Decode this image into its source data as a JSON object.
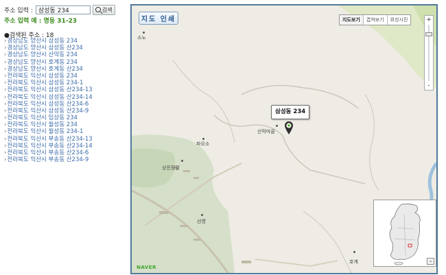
{
  "search": {
    "label": "주소 입력 :",
    "value": "삼성동 234",
    "button_label": "검색",
    "example": "주소 입력 예 : 명동 31-23"
  },
  "results": {
    "count_label": "●검색된 주소 : 18",
    "items": [
      "경상남도 양산시 삼성동 234",
      "경상남도 양산시 삼성동 산234",
      "경상남도 양산시 산막동 234",
      "경상남도 양산시 호계동 234",
      "경상남도 양산시 호계동 산234",
      "전라북도 익산시 삼성동 234",
      "전라북도 익산시 삼성동 234-1",
      "전라북도 익산시 삼성동 산234-13",
      "전라북도 익산시 삼성동 산234-14",
      "전라북도 익산시 삼성동 산234-6",
      "전라북도 익산시 삼성동 산234-9",
      "전라북도 익산시 임상동 234",
      "전라북도 익산시 월성동 234",
      "전라북도 익산시 월성동 234-1",
      "전라북도 익산시 부송동 산234-13",
      "전라북도 익산시 부송동 산234-14",
      "전라북도 익산시 부송동 산234-6",
      "전라북도 익산시 부송동 산234-9"
    ]
  },
  "map": {
    "print_label": "지도 인쇄",
    "map_types": [
      "지도보기",
      "겹쳐보기",
      "위성시진"
    ],
    "active_map_type": "지도보기",
    "zoom_in": "+",
    "zoom_out": "-",
    "marker_label": "삼성동 234",
    "places": {
      "sono": "소노",
      "sanmak": "산막마을",
      "pao": "파오소",
      "sangjin": "상진정말",
      "seonyeong": "선영",
      "hogye": "호계"
    },
    "logo": "NAVER",
    "colors": {
      "border": "#50789a",
      "marker": "#4aa81c",
      "logo": "#3ea52b"
    }
  }
}
